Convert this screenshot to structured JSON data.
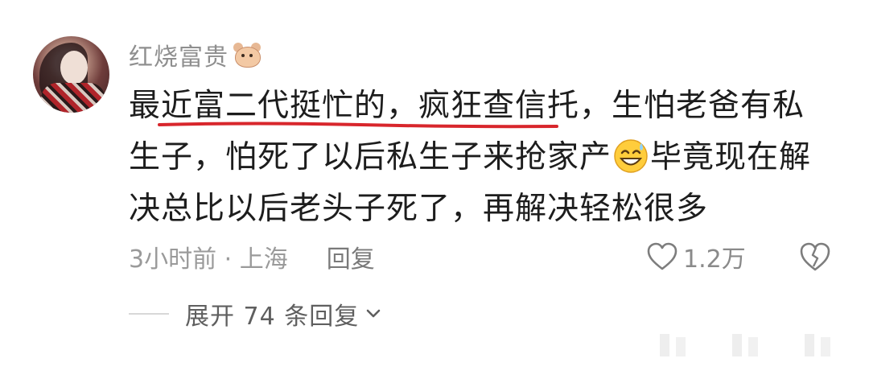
{
  "comment": {
    "username": "红烧富贵",
    "username_badge_icon": "hamster-icon",
    "text_part1": "最近富二代挺忙的，疯狂查信托，生怕老爸有私生子，怕死了以后私生子来抢家产",
    "inline_emoji_icon": "grinning-sweat-emoji",
    "text_part2": "毕竟现在解决总比以后老头子死了，再解决轻松很多",
    "underline_color": "#d8262c",
    "time_location": "3小时前 · 上海",
    "reply_label": "回复",
    "like_count": "1.2万",
    "expand_replies_label": "展开 74 条回复"
  },
  "icons": {
    "like": "heart-outline-icon",
    "dislike": "broken-heart-icon",
    "expand": "chevron-down-icon"
  }
}
